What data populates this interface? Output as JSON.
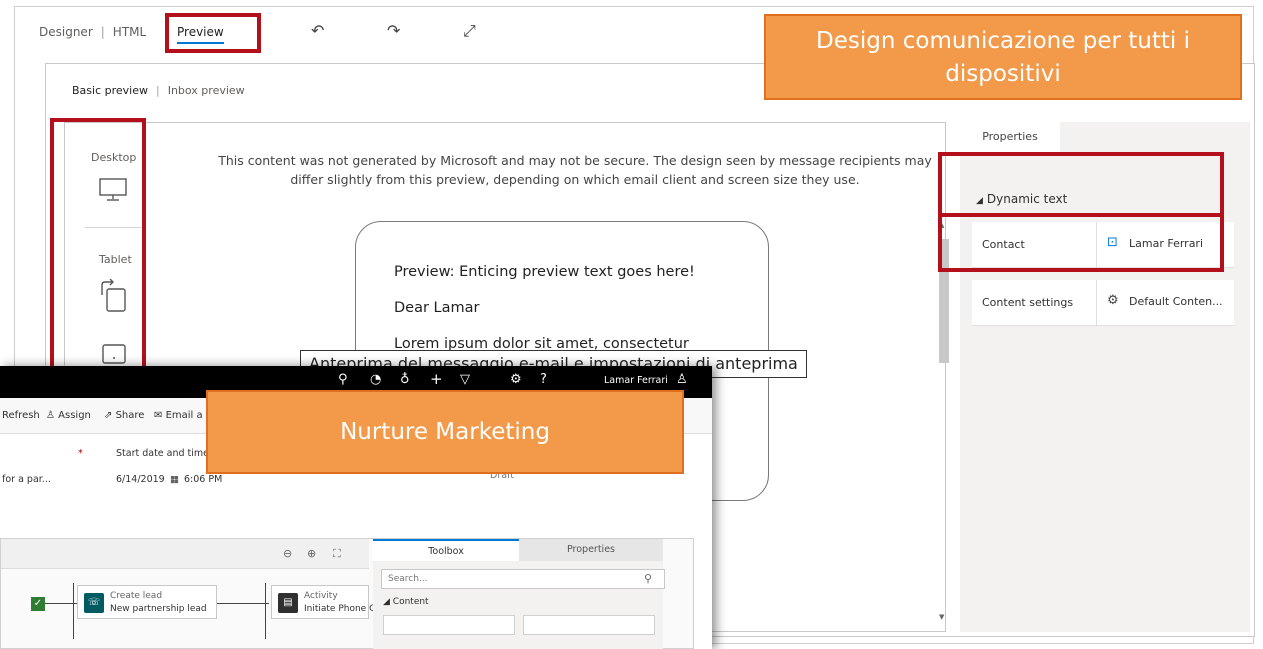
{
  "designer": {
    "tabs": [
      "Designer",
      "HTML",
      "Preview"
    ],
    "sub_tabs": [
      "Basic preview",
      "Inbox preview"
    ],
    "devices": [
      "Desktop",
      "Tablet"
    ],
    "notice": "This content was not generated by Microsoft and may not be secure. The design seen by message recipients may differ slightly from this preview, depending on which email client and screen size they use.",
    "email": {
      "preview_line": "Preview: Enticing preview text goes here!",
      "greeting": "Dear Lamar",
      "body": "Lorem ipsum dolor sit amet, consectetur"
    },
    "properties": {
      "tab": "Properties",
      "section": "Dynamic text",
      "rows": [
        {
          "label": "Contact",
          "value": "Lamar Ferrari"
        },
        {
          "label": "Content settings",
          "value": "Default Conten..."
        }
      ]
    }
  },
  "callouts": {
    "design": "Design comunicazione per tutti i dispositivi",
    "nurture": "Nurture Marketing"
  },
  "tooltip": "Anteprima del messaggio e-mail e impostazioni di anteprima",
  "nurture": {
    "user": "Lamar Ferrari",
    "commands": [
      "Refresh",
      "Assign",
      "Share",
      "Email a"
    ],
    "start_label": "Start date and time",
    "date": "6/14/2019",
    "time": "6:06 PM",
    "name_truncated": "for a par...",
    "status": "Draft",
    "canvas_tiles": [
      {
        "kind": "Create lead",
        "name": "New partnership lead"
      },
      {
        "kind": "Activity",
        "name": "Initiate Phone C"
      }
    ],
    "toolbox": {
      "tabs": [
        "Toolbox",
        "Properties"
      ],
      "search_placeholder": "Search...",
      "section": "Content"
    }
  }
}
